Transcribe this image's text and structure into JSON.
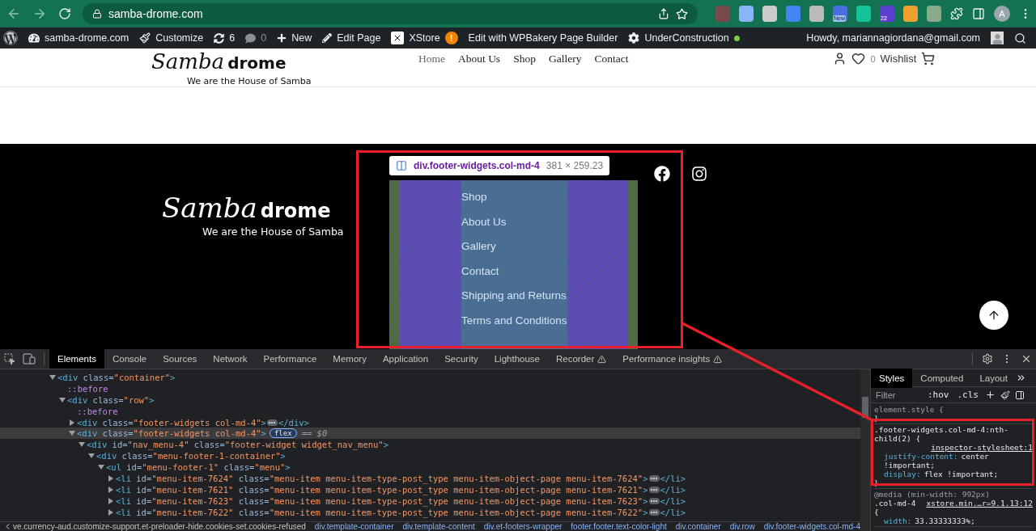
{
  "browser": {
    "url": "samba-drome.com",
    "extensions": [
      {
        "kind": "plain"
      },
      {
        "kind": "plain"
      },
      {
        "kind": "plain"
      },
      {
        "kind": "plain"
      },
      {
        "kind": "plain"
      },
      {
        "kind": "badged",
        "badge": "New"
      },
      {
        "kind": "plain"
      },
      {
        "kind": "badged",
        "badge": "22"
      },
      {
        "kind": "plain"
      },
      {
        "kind": "plain"
      }
    ],
    "profile": "A"
  },
  "admin_bar": {
    "items": [
      {
        "kind": "site",
        "label": "samba-drome.com"
      },
      {
        "kind": "customize",
        "label": "Customize"
      },
      {
        "kind": "updates",
        "label": "6"
      },
      {
        "kind": "comments",
        "label": "0"
      },
      {
        "kind": "new",
        "label": "New"
      },
      {
        "kind": "edit",
        "label": "Edit Page"
      },
      {
        "kind": "xstore",
        "label": "XStore",
        "alert": "!"
      },
      {
        "kind": "plain",
        "label": "Edit with WPBakery Page Builder"
      },
      {
        "kind": "status",
        "label": "UnderConstruction"
      }
    ],
    "greeting": "Howdy, mariannagiordana@gmail.com"
  },
  "header": {
    "logo": {
      "script": "Samba",
      "bold": "drome",
      "tagline": "We are the House of Samba"
    },
    "nav": [
      {
        "label": "Home",
        "selected": true
      },
      {
        "label": "About Us",
        "selected": false
      },
      {
        "label": "Shop",
        "selected": false
      },
      {
        "label": "Gallery",
        "selected": false
      },
      {
        "label": "Contact",
        "selected": false
      }
    ],
    "wishlist_count": "0",
    "wishlist_label": "Wishlist"
  },
  "footer": {
    "logo": {
      "script": "Samba",
      "bold": "drome",
      "tagline": "We are the House of Samba"
    },
    "tooltip": {
      "selector": "div.footer-widgets.col-md-4",
      "size": "381 × 259.23"
    },
    "menu": [
      "Shop",
      "About Us",
      "Gallery",
      "Contact",
      "Shipping and Returns",
      "Terms and Conditions"
    ]
  },
  "devtools": {
    "tabs": [
      {
        "label": "Elements",
        "selected": true,
        "warning": false
      },
      {
        "label": "Console",
        "selected": false,
        "warning": false
      },
      {
        "label": "Sources",
        "selected": false,
        "warning": false
      },
      {
        "label": "Network",
        "selected": false,
        "warning": false
      },
      {
        "label": "Performance",
        "selected": false,
        "warning": false
      },
      {
        "label": "Memory",
        "selected": false,
        "warning": false
      },
      {
        "label": "Application",
        "selected": false,
        "warning": false
      },
      {
        "label": "Security",
        "selected": false,
        "warning": false
      },
      {
        "label": "Lighthouse",
        "selected": false,
        "warning": false
      },
      {
        "label": "Recorder",
        "selected": false,
        "warning": true
      },
      {
        "label": "Performance insights",
        "selected": false,
        "warning": true
      }
    ],
    "tree": [
      {
        "kind": "element",
        "expanded": true,
        "selected": false,
        "segments": [
          {
            "kind": "tag",
            "text": "<div"
          },
          {
            "kind": "attr",
            "text": " class="
          },
          {
            "kind": "value",
            "text": "\"container\""
          },
          {
            "kind": "tag",
            "text": ">"
          }
        ],
        "children": [
          {
            "kind": "pseudo",
            "selected": false,
            "segments": [
              {
                "kind": "pseudo",
                "text": "::before"
              }
            ]
          },
          {
            "kind": "element",
            "expanded": true,
            "selected": false,
            "segments": [
              {
                "kind": "tag",
                "text": "<div"
              },
              {
                "kind": "attr",
                "text": " class="
              },
              {
                "kind": "value",
                "text": "\"row\""
              },
              {
                "kind": "tag",
                "text": ">"
              }
            ],
            "children": [
              {
                "kind": "pseudo",
                "selected": false,
                "segments": [
                  {
                    "kind": "pseudo",
                    "text": "::before"
                  }
                ]
              },
              {
                "kind": "element",
                "expanded": false,
                "selected": false,
                "segments": [
                  {
                    "kind": "tag",
                    "text": "<div"
                  },
                  {
                    "kind": "attr",
                    "text": " class="
                  },
                  {
                    "kind": "value",
                    "text": "\"footer-widgets col-md-4\""
                  },
                  {
                    "kind": "tag",
                    "text": ">"
                  }
                ],
                "closing": "</div>"
              },
              {
                "kind": "element",
                "expanded": true,
                "selected": true,
                "badge": "flex",
                "note": "== $0",
                "segments": [
                  {
                    "kind": "tag",
                    "text": "<div"
                  },
                  {
                    "kind": "attr",
                    "text": " class="
                  },
                  {
                    "kind": "value",
                    "text": "\"footer-widgets col-md-4\""
                  },
                  {
                    "kind": "tag",
                    "text": ">"
                  }
                ],
                "children": [
                  {
                    "kind": "element",
                    "expanded": true,
                    "selected": false,
                    "segments": [
                      {
                        "kind": "tag",
                        "text": "<div"
                      },
                      {
                        "kind": "attr",
                        "text": " id="
                      },
                      {
                        "kind": "value",
                        "text": "\"nav_menu-4\""
                      },
                      {
                        "kind": "attr",
                        "text": " class="
                      },
                      {
                        "kind": "value",
                        "text": "\"footer-widget widget_nav_menu\""
                      },
                      {
                        "kind": "tag",
                        "text": ">"
                      }
                    ],
                    "children": [
                      {
                        "kind": "element",
                        "expanded": true,
                        "selected": false,
                        "segments": [
                          {
                            "kind": "tag",
                            "text": "<div"
                          },
                          {
                            "kind": "attr",
                            "text": " class="
                          },
                          {
                            "kind": "value",
                            "text": "\"menu-footer-1-container\""
                          },
                          {
                            "kind": "tag",
                            "text": ">"
                          }
                        ],
                        "children": [
                          {
                            "kind": "element",
                            "expanded": true,
                            "selected": false,
                            "segments": [
                              {
                                "kind": "tag",
                                "text": "<ul"
                              },
                              {
                                "kind": "attr",
                                "text": " id="
                              },
                              {
                                "kind": "value",
                                "text": "\"menu-footer-1\""
                              },
                              {
                                "kind": "attr",
                                "text": " class="
                              },
                              {
                                "kind": "value",
                                "text": "\"menu\""
                              },
                              {
                                "kind": "tag",
                                "text": ">"
                              }
                            ],
                            "children": [
                              {
                                "kind": "element",
                                "expanded": false,
                                "selected": false,
                                "segments": [
                                  {
                                    "kind": "tag",
                                    "text": "<li"
                                  },
                                  {
                                    "kind": "attr",
                                    "text": " id="
                                  },
                                  {
                                    "kind": "value",
                                    "text": "\"menu-item-7624\""
                                  },
                                  {
                                    "kind": "attr",
                                    "text": " class="
                                  },
                                  {
                                    "kind": "value",
                                    "text": "\"menu-item menu-item-type-post_type menu-item-object-page menu-item-7624\""
                                  },
                                  {
                                    "kind": "tag",
                                    "text": ">"
                                  }
                                ],
                                "closing": "</li>"
                              },
                              {
                                "kind": "element",
                                "expanded": false,
                                "selected": false,
                                "segments": [
                                  {
                                    "kind": "tag",
                                    "text": "<li"
                                  },
                                  {
                                    "kind": "attr",
                                    "text": " id="
                                  },
                                  {
                                    "kind": "value",
                                    "text": "\"menu-item-7621\""
                                  },
                                  {
                                    "kind": "attr",
                                    "text": " class="
                                  },
                                  {
                                    "kind": "value",
                                    "text": "\"menu-item menu-item-type-post_type menu-item-object-page menu-item-7621\""
                                  },
                                  {
                                    "kind": "tag",
                                    "text": ">"
                                  }
                                ],
                                "closing": "</li>"
                              },
                              {
                                "kind": "element",
                                "expanded": false,
                                "selected": false,
                                "segments": [
                                  {
                                    "kind": "tag",
                                    "text": "<li"
                                  },
                                  {
                                    "kind": "attr",
                                    "text": " id="
                                  },
                                  {
                                    "kind": "value",
                                    "text": "\"menu-item-7623\""
                                  },
                                  {
                                    "kind": "attr",
                                    "text": " class="
                                  },
                                  {
                                    "kind": "value",
                                    "text": "\"menu-item menu-item-type-post_type menu-item-object-page menu-item-7623\""
                                  },
                                  {
                                    "kind": "tag",
                                    "text": ">"
                                  }
                                ],
                                "closing": "</li>"
                              },
                              {
                                "kind": "element",
                                "expanded": false,
                                "selected": false,
                                "segments": [
                                  {
                                    "kind": "tag",
                                    "text": "<li"
                                  },
                                  {
                                    "kind": "attr",
                                    "text": " id="
                                  },
                                  {
                                    "kind": "value",
                                    "text": "\"menu-item-7622\""
                                  },
                                  {
                                    "kind": "attr",
                                    "text": " class="
                                  },
                                  {
                                    "kind": "value",
                                    "text": "\"menu-item menu-item-type-post_type menu-item-object-page menu-item-7622\""
                                  },
                                  {
                                    "kind": "tag",
                                    "text": ">"
                                  }
                                ],
                                "closing": "</li>"
                              }
                            ]
                          }
                        ]
                      }
                    ]
                  }
                ]
              }
            ]
          }
        ]
      }
    ],
    "breadcrumb": [
      "ve.currency-aud.customize-support.et-preloader-hide.cookies-set.cookies-refused",
      "div.template-container",
      "div.template-content",
      "div.et-footers-wrapper",
      "footer.footer.text-color-light",
      "div.container",
      "div.row",
      "div.footer-widgets.col-md-4"
    ],
    "styles": {
      "tabs": [
        {
          "label": "Styles",
          "selected": true
        },
        {
          "label": "Computed",
          "selected": false
        },
        {
          "label": "Layout",
          "selected": false
        }
      ],
      "filter_placeholder": "Filter",
      "toggles": [
        ":hov",
        ".cls"
      ],
      "rules": [
        {
          "selector": "element.style {",
          "close": "}"
        },
        {
          "selector": ".footer-widgets.col-md-4:nth-child(2) {",
          "source": "inspector-stylesheet:1",
          "declarations": [
            {
              "property": "justify-content:",
              "value": "center !important;"
            },
            {
              "property": "display:",
              "value": "flex !important;"
            }
          ],
          "close": "}"
        },
        {
          "media": "@media (min-width: 992px)",
          "selector": ".col-md-4",
          "source": "xstore.min.…r=9.1.13:12",
          "open": "{",
          "declarations": [
            {
              "property": "width:",
              "value": "33.33333333%;"
            }
          ]
        }
      ]
    }
  }
}
